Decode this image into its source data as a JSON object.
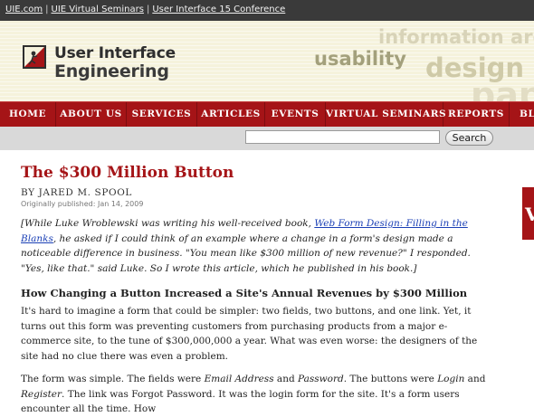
{
  "topbar": {
    "links": [
      "UIE.com",
      "UIE Virtual Seminars",
      "User Interface 15 Conference"
    ],
    "separator": "|"
  },
  "banner": {
    "logo_line1": "User Interface",
    "logo_line2": "Engineering",
    "deco_words": [
      "information archi",
      "usability",
      "design",
      "pape"
    ]
  },
  "nav": {
    "items": [
      "HOME",
      "ABOUT US",
      "SERVICES",
      "ARTICLES",
      "EVENTS",
      "VIRTUAL SEMINARS",
      "REPORTS",
      "BL"
    ]
  },
  "search": {
    "value": "",
    "button_label": "Search"
  },
  "article": {
    "title": "The $300 Million Button",
    "byline": "BY JARED M. SPOOL",
    "published": "Originally published: Jan 14, 2009",
    "intro_before": "[While Luke Wroblewski was writing his well-received book, ",
    "intro_link": "Web Form Design: Filling in the Blanks",
    "intro_after": ", he asked if I could think of an example where a change in a form's design made a noticeable difference in business. \"You mean like $300 million of new revenue?\" I responded. \"Yes, like that.\" said Luke. So I wrote this article, which he published in his book.]",
    "heading": "How Changing a Button Increased a Site's Annual Revenues by $300 Million",
    "para1": "It's hard to imagine a form that could be simpler: two fields, two buttons, and one link. Yet, it turns out this form was preventing customers from purchasing products from a major e-commerce site, to the tune of $300,000,000 a year. What was even worse: the designers of the site had no clue there was even a problem.",
    "para2_a": "The form was simple. The fields were ",
    "para2_b": "Email Address",
    "para2_c": " and ",
    "para2_d": "Password",
    "para2_e": ". The buttons were ",
    "para2_f": "Login",
    "para2_g": " and ",
    "para2_h": "Register",
    "para2_i": ". The link was Forgot Password. It was the login form for the site. It's a form users encounter all the time. How"
  },
  "sidebar": {
    "box_letter": "V"
  },
  "colors": {
    "brand_red": "#a51417",
    "banner_bg": "#f5f2dc",
    "link_blue": "#1a3fb5"
  }
}
